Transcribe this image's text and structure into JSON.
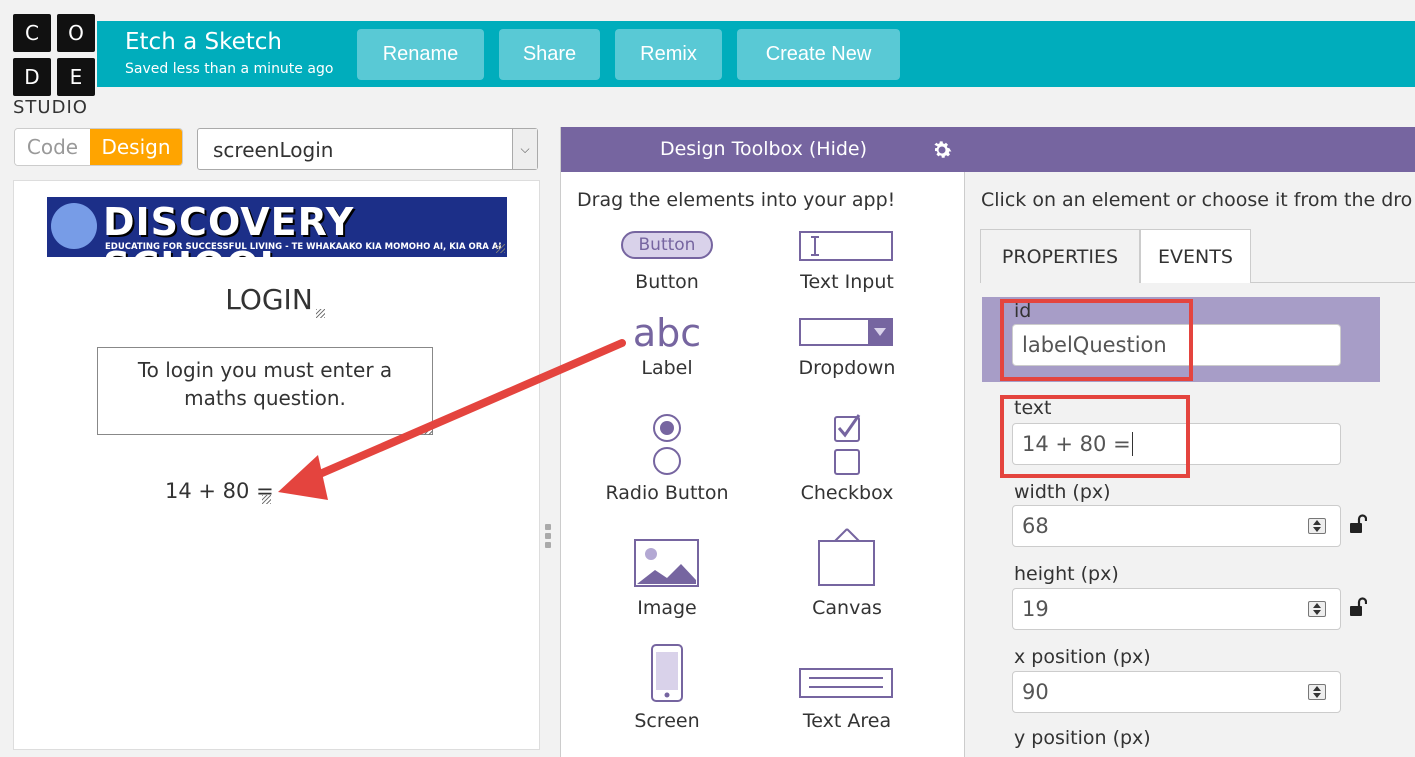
{
  "logo": {
    "letters": [
      "C",
      "O",
      "D",
      "E"
    ],
    "studio": "STUDIO"
  },
  "header": {
    "project_name": "Etch a Sketch",
    "saved_status": "Saved less than a minute ago",
    "buttons": {
      "rename": "Rename",
      "share": "Share",
      "remix": "Remix",
      "create_new": "Create New"
    }
  },
  "mode_toggle": {
    "code": "Code",
    "design": "Design",
    "active": "Design"
  },
  "screen_dropdown": {
    "value": "screenLogin"
  },
  "app": {
    "banner": {
      "title": "DISCOVERY SCHOOL",
      "subtitle": "EDUCATING FOR SUCCESSFUL LIVING - TE WHAKAAKO KIA MOMOHO AI, KIA ORA AI"
    },
    "login_title": "LOGIN",
    "message": "To login you must enter a maths question.",
    "question": "14 + 80 ="
  },
  "toolbox": {
    "title": "Design Toolbox (Hide)",
    "hint": "Drag the elements into your app!",
    "items": [
      {
        "label": "Button",
        "icon": "button-icon",
        "icon_text": "Button"
      },
      {
        "label": "Text Input",
        "icon": "text-input-icon"
      },
      {
        "label": "Label",
        "icon": "label-icon",
        "icon_text": "abc"
      },
      {
        "label": "Dropdown",
        "icon": "dropdown-icon"
      },
      {
        "label": "Radio Button",
        "icon": "radio-button-icon"
      },
      {
        "label": "Checkbox",
        "icon": "checkbox-icon"
      },
      {
        "label": "Image",
        "icon": "image-icon"
      },
      {
        "label": "Canvas",
        "icon": "canvas-icon"
      },
      {
        "label": "Screen",
        "icon": "screen-icon"
      },
      {
        "label": "Text Area",
        "icon": "text-area-icon"
      }
    ]
  },
  "properties": {
    "hint": "Click on an element or choose it from the dro",
    "tabs": {
      "properties": "PROPERTIES",
      "events": "EVENTS",
      "active": "PROPERTIES"
    },
    "fields": {
      "id": {
        "label": "id",
        "value": "labelQuestion"
      },
      "text": {
        "label": "text",
        "value": "14 + 80 ="
      },
      "width": {
        "label": "width (px)",
        "value": "68"
      },
      "height": {
        "label": "height (px)",
        "value": "19"
      },
      "x": {
        "label": "x position (px)",
        "value": "90"
      },
      "y": {
        "label": "y position (px)"
      }
    }
  },
  "colors": {
    "header": "#00adbc",
    "header_button": "#59c9d5",
    "design_toggle": "#ffa400",
    "toolbox_purple": "#7665a0",
    "highlight": "#e4443e"
  }
}
